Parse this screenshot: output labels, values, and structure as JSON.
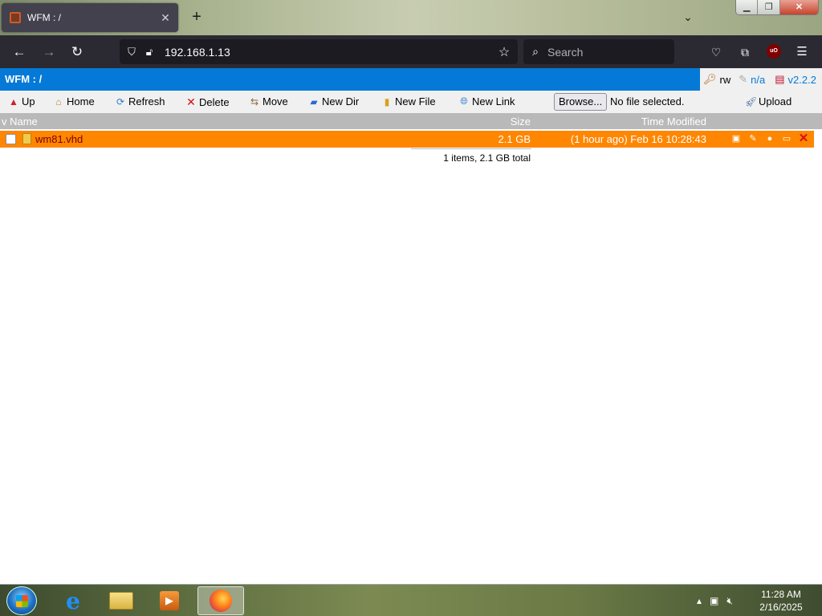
{
  "browser": {
    "tab_title": "WFM : /",
    "url": "192.168.1.13",
    "search_placeholder": "Search"
  },
  "wfm": {
    "title": "WFM : /",
    "perm": "rw",
    "na": "n/a",
    "version": "v2.2.2"
  },
  "toolbar": {
    "up": "Up",
    "home": "Home",
    "refresh": "Refresh",
    "delete": "Delete",
    "move": "Move",
    "new_dir": "New Dir",
    "new_file": "New File",
    "new_link": "New Link",
    "browse": "Browse...",
    "no_file": "No file selected.",
    "upload": "Upload"
  },
  "columns": {
    "name": "v Name",
    "size": "Size",
    "time": "Time Modified"
  },
  "files": [
    {
      "name": "wm81.vhd",
      "size": "2.1 GB",
      "time": "(1 hour ago) Feb 16 10:28:43"
    }
  ],
  "summary": "1 items, 2.1 GB total",
  "taskbar": {
    "time": "11:28 AM",
    "date": "2/16/2025"
  },
  "colors": {
    "header_blue": "#0479d7",
    "row_orange": "#fe8600",
    "list_header_gray": "#b9b9b9"
  }
}
